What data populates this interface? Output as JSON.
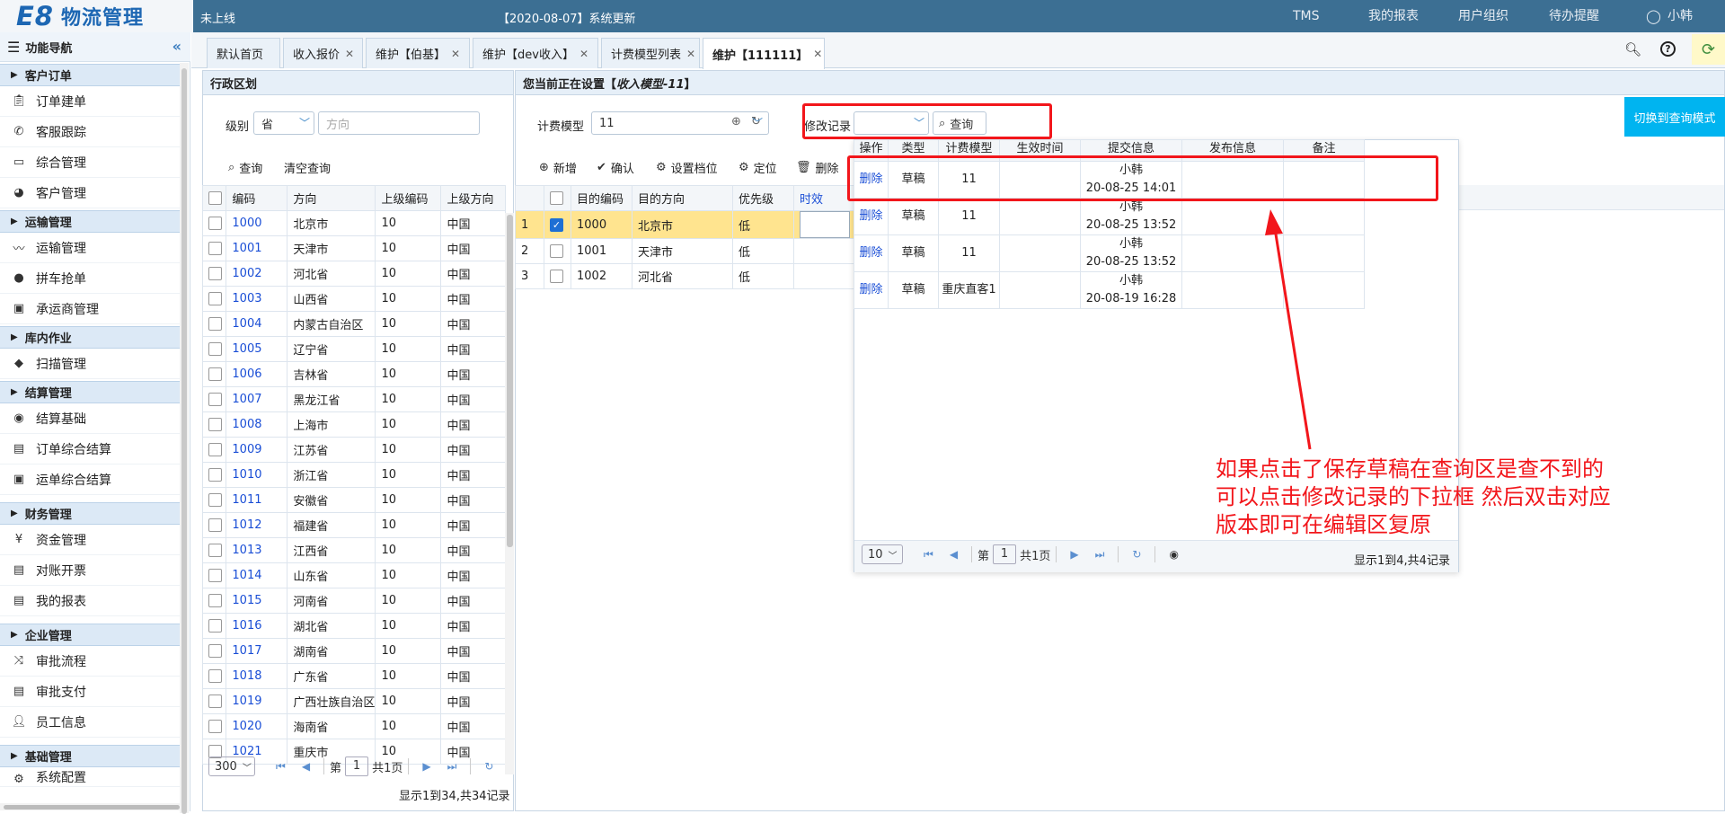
{
  "header": {
    "logo_e8": "E8",
    "logo_text": "物流管理",
    "state": "未上线",
    "news": "【2020-08-07】系统更新",
    "nav": [
      "TMS",
      "我的报表",
      "用户组织",
      "待办提醒"
    ],
    "user": "小韩",
    "user_icon": "user-icon"
  },
  "sidebar": {
    "title": "功能导航",
    "groups": [
      {
        "label": "客户订单",
        "items": [
          {
            "label": "订单建单",
            "icon": "clipboard-icon"
          },
          {
            "label": "客服跟踪",
            "icon": "phone-icon"
          },
          {
            "label": "综合管理",
            "icon": "monitor-icon"
          },
          {
            "label": "客户管理",
            "icon": "headset-icon"
          }
        ]
      },
      {
        "label": "运输管理",
        "items": [
          {
            "label": "运输管理",
            "icon": "route-icon"
          },
          {
            "label": "拼车抢单",
            "icon": "pin-icon"
          },
          {
            "label": "承运商管理",
            "icon": "bus-icon"
          }
        ]
      },
      {
        "label": "库内作业",
        "items": [
          {
            "label": "扫描管理",
            "icon": "box-icon"
          }
        ]
      },
      {
        "label": "结算管理",
        "items": [
          {
            "label": "结算基础",
            "icon": "eye-icon"
          },
          {
            "label": "订单综合结算",
            "icon": "document-icon"
          },
          {
            "label": "运单综合结算",
            "icon": "bus-icon"
          }
        ]
      },
      {
        "label": "财务管理",
        "items": [
          {
            "label": "资金管理",
            "icon": "yen-icon"
          },
          {
            "label": "对账开票",
            "icon": "document-icon"
          },
          {
            "label": "我的报表",
            "icon": "document-icon"
          }
        ]
      },
      {
        "label": "企业管理",
        "items": [
          {
            "label": "审批流程",
            "icon": "shuffle-icon"
          },
          {
            "label": "审批支付",
            "icon": "document-icon"
          },
          {
            "label": "员工信息",
            "icon": "user-icon"
          }
        ]
      },
      {
        "label": "基础管理",
        "items": [
          {
            "label": "系统配置",
            "icon": "gear-icon"
          }
        ]
      }
    ]
  },
  "tabs": [
    {
      "label": "默认首页",
      "closable": false
    },
    {
      "label": "收入报价",
      "closable": true
    },
    {
      "label": "维护【伯基】",
      "closable": true
    },
    {
      "label": "维护【dev收入】",
      "closable": true
    },
    {
      "label": "计费模型列表",
      "closable": true
    },
    {
      "label": "维护【111111】",
      "closable": true,
      "active": true
    }
  ],
  "left_panel": {
    "title": "行政区划",
    "level_label": "级别",
    "level_value": "省",
    "direction_placeholder": "方向",
    "query": "查询",
    "clear_query": "清空查询",
    "columns": [
      "编码",
      "方向",
      "上级编码",
      "上级方向"
    ],
    "rows": [
      [
        "1000",
        "北京市",
        "10",
        "中国"
      ],
      [
        "1001",
        "天津市",
        "10",
        "中国"
      ],
      [
        "1002",
        "河北省",
        "10",
        "中国"
      ],
      [
        "1003",
        "山西省",
        "10",
        "中国"
      ],
      [
        "1004",
        "内蒙古自治区",
        "10",
        "中国"
      ],
      [
        "1005",
        "辽宁省",
        "10",
        "中国"
      ],
      [
        "1006",
        "吉林省",
        "10",
        "中国"
      ],
      [
        "1007",
        "黑龙江省",
        "10",
        "中国"
      ],
      [
        "1008",
        "上海市",
        "10",
        "中国"
      ],
      [
        "1009",
        "江苏省",
        "10",
        "中国"
      ],
      [
        "1010",
        "浙江省",
        "10",
        "中国"
      ],
      [
        "1011",
        "安徽省",
        "10",
        "中国"
      ],
      [
        "1012",
        "福建省",
        "10",
        "中国"
      ],
      [
        "1013",
        "江西省",
        "10",
        "中国"
      ],
      [
        "1014",
        "山东省",
        "10",
        "中国"
      ],
      [
        "1015",
        "河南省",
        "10",
        "中国"
      ],
      [
        "1016",
        "湖北省",
        "10",
        "中国"
      ],
      [
        "1017",
        "湖南省",
        "10",
        "中国"
      ],
      [
        "1018",
        "广东省",
        "10",
        "中国"
      ],
      [
        "1019",
        "广西壮族自治区",
        "10",
        "中国"
      ],
      [
        "1020",
        "海南省",
        "10",
        "中国"
      ],
      [
        "1021",
        "重庆市",
        "10",
        "中国"
      ]
    ],
    "pager": {
      "page_size": "300",
      "page_label": "第",
      "page": "1",
      "total_pages": "共1页",
      "summary": "显示1到34,共34记录"
    }
  },
  "right_panel": {
    "title": "您当前正在设置【",
    "title_model": "收入模型-11",
    "title_end": "】",
    "model_label": "计费模型",
    "model_value": "11",
    "history_label": "修改记录",
    "query": "查询",
    "switch": "切换到查询模式",
    "toolbar": [
      "新增",
      "确认",
      "设置档位",
      "定位",
      "删除"
    ],
    "columns": [
      "目的编码",
      "目的方向",
      "优先级",
      "时效"
    ],
    "rows": [
      {
        "n": "1",
        "code": "1000",
        "dir": "北京市",
        "pri": "低",
        "checked": true
      },
      {
        "n": "2",
        "code": "1001",
        "dir": "天津市",
        "pri": "低",
        "checked": false
      },
      {
        "n": "3",
        "code": "1002",
        "dir": "河北省",
        "pri": "低",
        "checked": false
      }
    ]
  },
  "history": {
    "columns": [
      "操作",
      "类型",
      "计费模型",
      "生效时间",
      "提交信息",
      "发布信息",
      "备注"
    ],
    "rows": [
      {
        "op": "删除",
        "type": "草稿",
        "model": "11",
        "user": "小韩",
        "time": "20-08-25 14:01"
      },
      {
        "op": "删除",
        "type": "草稿",
        "model": "11",
        "user": "小韩",
        "time": "20-08-25 13:52"
      },
      {
        "op": "删除",
        "type": "草稿",
        "model": "11",
        "user": "小韩",
        "time": "20-08-25 13:52"
      },
      {
        "op": "删除",
        "type": "草稿",
        "model": "重庆直客1",
        "user": "小韩",
        "time": "20-08-19 16:28"
      }
    ],
    "pager": {
      "page_size": "10",
      "page_label": "第",
      "page": "1",
      "total_pages": "共1页",
      "summary": "显示1到4,共4记录"
    }
  },
  "annotation": {
    "lines": [
      "如果点击了保存草稿在查询区是查不到的",
      "可以点击修改记录的下拉框 然后双击对应",
      "版本即可在编辑区复原"
    ],
    "color": "#f2161b"
  }
}
